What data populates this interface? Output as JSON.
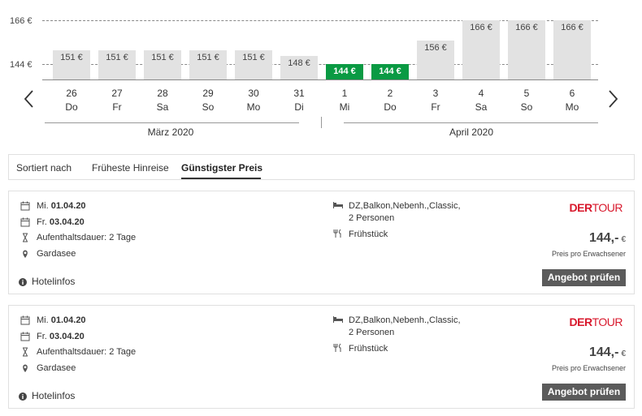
{
  "chart_data": {
    "type": "bar",
    "ytick_labels": [
      "166 €",
      "144 €"
    ],
    "yticks": [
      166,
      144
    ],
    "ylim": [
      144,
      166
    ],
    "categories": [
      "26",
      "27",
      "28",
      "29",
      "30",
      "31",
      "1",
      "2",
      "3",
      "4",
      "5",
      "6"
    ],
    "day_names": [
      "Do",
      "Fr",
      "Sa",
      "So",
      "Mo",
      "Di",
      "Mi",
      "Do",
      "Fr",
      "Sa",
      "So",
      "Mo"
    ],
    "values": [
      151,
      151,
      151,
      151,
      151,
      148,
      144,
      144,
      156,
      166,
      166,
      166
    ],
    "value_labels": [
      "151 €",
      "151 €",
      "151 €",
      "151 €",
      "151 €",
      "148 €",
      "144 €",
      "144 €",
      "156 €",
      "166 €",
      "166 €",
      "166 €"
    ],
    "cheapest": [
      false,
      false,
      false,
      false,
      false,
      false,
      true,
      true,
      false,
      false,
      false,
      false
    ],
    "months": [
      "März 2020",
      "April 2020"
    ],
    "colors": {
      "bar": "#e2e2e2",
      "cheapest": "#0a9a43"
    }
  },
  "sort": {
    "label": "Sortiert nach",
    "options": [
      "Früheste Hinreise",
      "Günstigster Preis"
    ],
    "active": "Günstigster Preis"
  },
  "offers": [
    {
      "depart_day": "Mi.",
      "depart_date": "01.04.20",
      "return_day": "Fr.",
      "return_date": "03.04.20",
      "duration": "Aufenthaltsdauer: 2 Tage",
      "location": "Gardasee",
      "room": "DZ,Balkon,Nebenh.,Classic,",
      "persons": "2 Personen",
      "board": "Frühstück",
      "operator_brand_a": "DER",
      "operator_brand_b": "TOUR",
      "price": "144,-",
      "currency": "€",
      "price_note": "Preis pro Erwachsener",
      "cta": "Angebot prüfen",
      "hotelinfo": "Hotelinfos"
    },
    {
      "depart_day": "Mi.",
      "depart_date": "01.04.20",
      "return_day": "Fr.",
      "return_date": "03.04.20",
      "duration": "Aufenthaltsdauer: 2 Tage",
      "location": "Gardasee",
      "room": "DZ,Balkon,Nebenh.,Classic,",
      "persons": "2 Personen",
      "board": "Frühstück",
      "operator_brand_a": "DER",
      "operator_brand_b": "TOUR",
      "price": "144,-",
      "currency": "€",
      "price_note": "Preis pro Erwachsener",
      "cta": "Angebot prüfen",
      "hotelinfo": "Hotelinfos"
    }
  ],
  "icons": {
    "prev": "chevron-left-icon",
    "next": "chevron-right-icon",
    "calendar": "calendar-icon",
    "hourglass": "hourglass-icon",
    "location": "location-pin-icon",
    "bed": "bed-icon",
    "cutlery": "cutlery-icon",
    "info": "info-icon"
  }
}
